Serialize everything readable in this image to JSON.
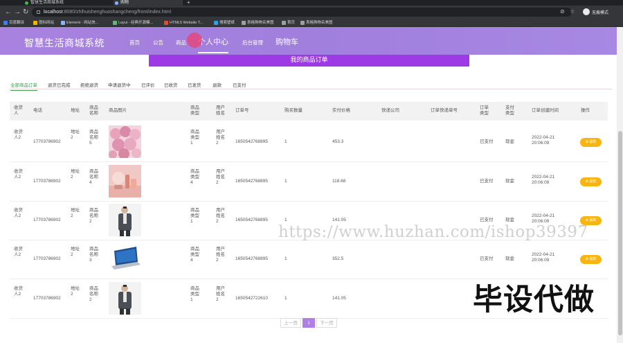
{
  "browser": {
    "tabs": [
      {
        "title": "智慧生活商城系统",
        "active": false
      },
      {
        "title": "购物",
        "active": true
      }
    ],
    "new_tab": "+",
    "nav_icons": [
      "back-icon",
      "forward-icon",
      "reload-icon"
    ],
    "url_host": "localhost",
    "url_rest": ":8080/zhihuishenghuoshangcheng/front/index.html",
    "profile": "无痕模式",
    "bookmarks": [
      "百度翻译",
      "图标网站",
      "Element - 网站快...",
      "Layui - 经典开源模...",
      "HTML5 Website T...",
      "搜索壁纸",
      "表格购物名美图",
      "首页",
      "表格购物名美图"
    ]
  },
  "header": {
    "logo": "智慧生活商城系统",
    "nav": [
      "首页",
      "公告",
      "商品",
      "个人中心",
      "后台管理",
      "购物车"
    ],
    "nav_current": "个人中心"
  },
  "page": {
    "subtitle": "我的商品订单",
    "filter_tabs": [
      "全部商品订单",
      "退货已完成",
      "拒绝退货",
      "申请退货中",
      "已评价",
      "已收货",
      "已发货",
      "退款",
      "已支付"
    ],
    "filter_current": "全部商品订单"
  },
  "table": {
    "columns": [
      "收货人",
      "电话",
      "地址",
      "商品名称",
      "商品图片",
      "商品类型",
      "用户姓名",
      "订单号",
      "购买数量",
      "实付价格",
      "快递公司",
      "订单快递单号",
      "订单类型",
      "支付类型",
      "订单创建时间",
      "操作"
    ],
    "rows": [
      {
        "receiver": "收货人2",
        "phone": "17703786902",
        "address": "地址2",
        "product": "商品名称5",
        "image": "pink-roses",
        "type": "商品类型1",
        "user": "用户姓名2",
        "order_no": "1650542768895",
        "qty": "1",
        "price": "453.3",
        "courier": "",
        "tracking": "",
        "order_type": "已支付",
        "pay_type": "现金",
        "created": "2022-04-21 20:06:09",
        "action": "退款"
      },
      {
        "receiver": "收货人2",
        "phone": "17703786902",
        "address": "地址2",
        "product": "商品名称4",
        "image": "pink-cosmetics",
        "type": "商品类型4",
        "user": "用户姓名2",
        "order_no": "1650542768895",
        "qty": "1",
        "price": "118.68",
        "courier": "",
        "tracking": "",
        "order_type": "已支付",
        "pay_type": "现金",
        "created": "2022-04-21 20:06:09",
        "action": "退款"
      },
      {
        "receiver": "收货人2",
        "phone": "17703786902",
        "address": "地址2",
        "product": "商品名称2",
        "image": "man-in-suit",
        "type": "商品类型1",
        "user": "用户姓名2",
        "order_no": "1650542768895",
        "qty": "1",
        "price": "141.05",
        "courier": "",
        "tracking": "",
        "order_type": "已支付",
        "pay_type": "现金",
        "created": "2022-04-21 20:06:09",
        "action": "退款"
      },
      {
        "receiver": "收货人2",
        "phone": "17703786902",
        "address": "地址2",
        "product": "商品名称3",
        "image": "laptop",
        "type": "商品类型4",
        "user": "用户姓名2",
        "order_no": "1650542768895",
        "qty": "1",
        "price": "352.5",
        "courier": "",
        "tracking": "",
        "order_type": "已支付",
        "pay_type": "现金",
        "created": "2022-04-21 20:06:09",
        "action": "退款"
      },
      {
        "receiver": "收货人2",
        "phone": "17703786902",
        "address": "地址2",
        "product": "商品名称2",
        "image": "man-in-suit",
        "type": "商品类型1",
        "user": "用户姓名2",
        "order_no": "1650542722610",
        "qty": "1",
        "price": "141.05",
        "courier": "",
        "tracking": "",
        "order_type": "",
        "pay_type": "",
        "created": "",
        "action": ""
      }
    ]
  },
  "pager": {
    "prev": "上一页",
    "current": "1",
    "next": "下一页"
  },
  "watermarks": {
    "url": "https://www.huzhan.com/ishop39397",
    "text": "毕设代做"
  },
  "colors": {
    "header": "#a07fdd",
    "subtitle_bar": "#9d3ae5",
    "active_filter": "#3a9a4e",
    "action_button": "#f6b511",
    "pager_active": "#b07fe2"
  }
}
